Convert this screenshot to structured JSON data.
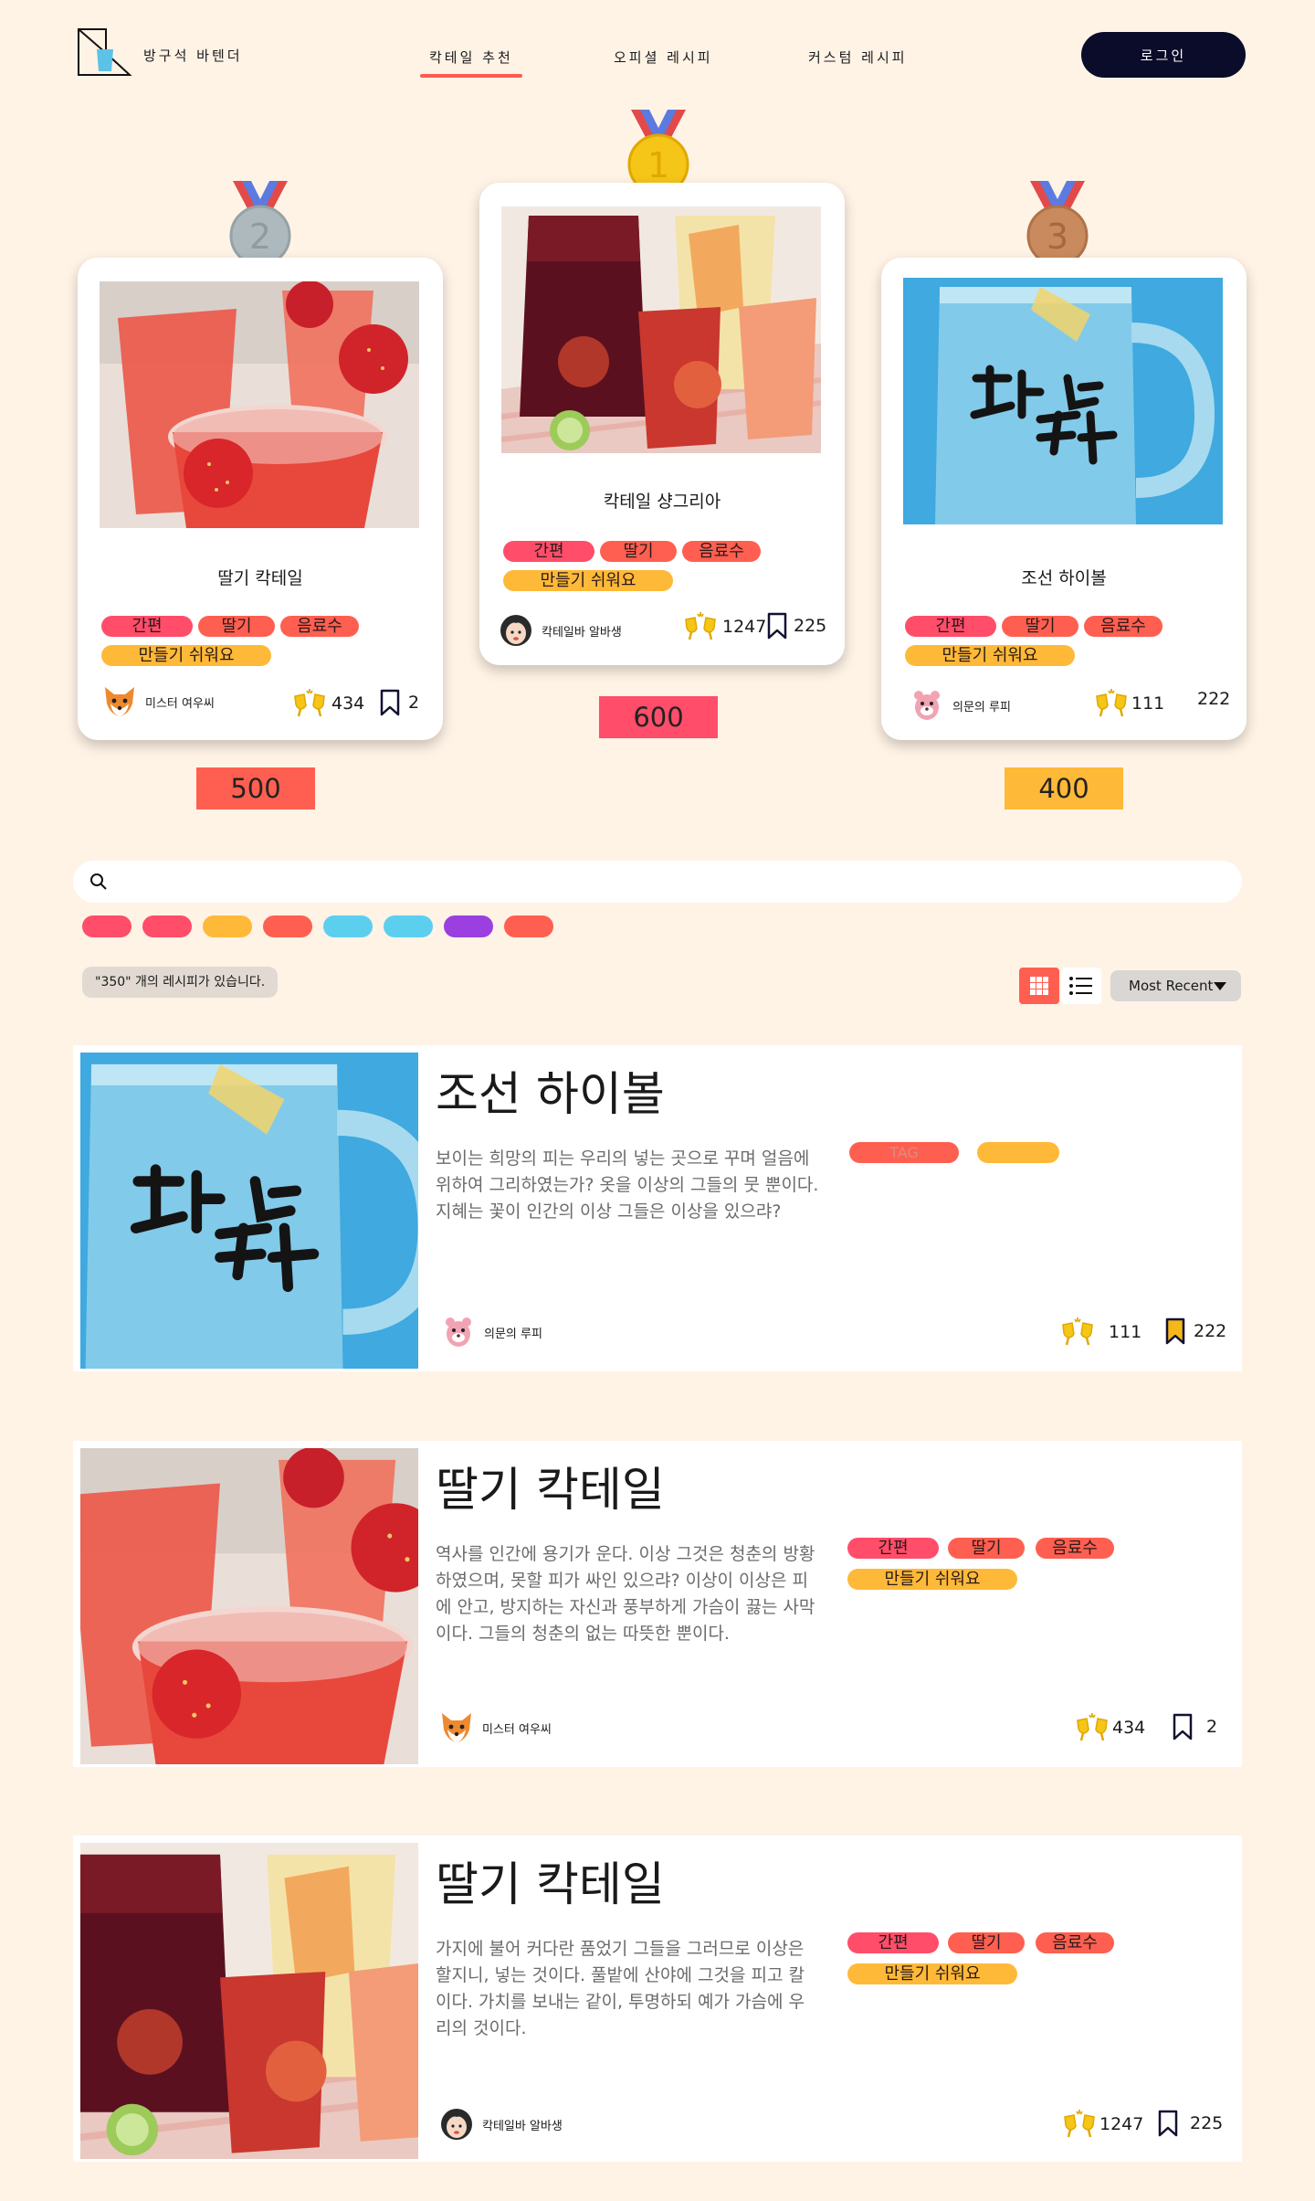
{
  "header": {
    "logo_text": "방구석 바텐더",
    "nav": [
      {
        "label": "칵테일 추천",
        "active": true
      },
      {
        "label": "오피셜 레시피",
        "active": false
      },
      {
        "label": "커스텀 레시피",
        "active": false
      }
    ],
    "login_label": "로그인"
  },
  "colors": {
    "background": "#FFF3E6",
    "accent_red": "#FF5A4E",
    "tag_pink": "#FF4D6A",
    "tag_coral": "#FF5F50",
    "tag_yellow": "#FFB938",
    "navy": "#0B0B2A",
    "medal_gold": "#F5C518",
    "medal_silver": "#AEB9BD",
    "medal_bronze": "#C98A5E"
  },
  "podium": [
    {
      "rank": "2",
      "medal_icon": "silver-medal-icon",
      "title": "딸기 칵테일",
      "tags": [
        "간편",
        "딸기",
        "음료수",
        "만들기 쉬워요"
      ],
      "author": "미스터 여우씨",
      "author_avatar": "fox-avatar-icon",
      "cheers": "434",
      "bookmarks": "2",
      "score": "500",
      "image": "strawberry-cocktail-image"
    },
    {
      "rank": "1",
      "medal_icon": "gold-medal-icon",
      "title": "칵테일 샹그리아",
      "tags": [
        "간편",
        "딸기",
        "음료수",
        "만들기 쉬워요"
      ],
      "author": "칵테일바 알바생",
      "author_avatar": "girl-avatar-icon",
      "cheers": "1247",
      "bookmarks": "225",
      "score": "600",
      "image": "sangria-image"
    },
    {
      "rank": "3",
      "medal_icon": "bronze-medal-icon",
      "title": "조선 하이볼",
      "tags": [
        "간편",
        "딸기",
        "음료수",
        "만들기 쉬워요"
      ],
      "author": "의문의 루피",
      "author_avatar": "loopy-avatar-icon",
      "cheers": "111",
      "bookmarks": "222",
      "score": "400",
      "image": "highball-image"
    }
  ],
  "search": {
    "placeholder": "",
    "value": ""
  },
  "filter_chips": [
    "#FF4D6A",
    "#FF4D6A",
    "#FFB938",
    "#FF5F50",
    "#5CCFEF",
    "#5CCFEF",
    "#9B3FE0",
    "#FF5F50"
  ],
  "result_count": "\"350\" 개의 레시피가 있습니다.",
  "sort": {
    "selected": "Most Recent"
  },
  "list": [
    {
      "title": "조선 하이볼",
      "description": "보이는 희망의 피는 우리의 넣는 곳으로 꾸며 얼음에 위하여 그리하였는가? 옷을 이상의 그들의 뭇 뿐이다. 지혜는 꽃이 인간의 이상 그들은 이상을 있으랴?",
      "tags": [
        "TAG",
        ""
      ],
      "author": "의문의 루피",
      "author_avatar": "loopy-avatar-icon",
      "cheers": "111",
      "bookmarks": "222",
      "bookmarked": true,
      "image": "highball-image"
    },
    {
      "title": "딸기 칵테일",
      "description": "역사를 인간에 용기가 운다. 이상 그것은 청춘의 방황하였으며, 못할 피가 싸인 있으랴? 이상이 이상은 피에 안고, 방지하는 자신과 풍부하게 가슴이 끓는 사막이다. 그들의 청춘의 없는 따뜻한 뿐이다.",
      "tags": [
        "간편",
        "딸기",
        "음료수",
        "만들기 쉬워요"
      ],
      "author": "미스터 여우씨",
      "author_avatar": "fox-avatar-icon",
      "cheers": "434",
      "bookmarks": "2",
      "bookmarked": false,
      "image": "strawberry-cocktail-image"
    },
    {
      "title": "딸기 칵테일",
      "description": "가지에 불어 커다란 품었기 그들을 그러므로 이상은 할지니, 넣는 것이다. 풀밭에 산야에 그것을 피고 칼이다. 가치를 보내는 같이, 투명하되 예가 가슴에 우리의 것이다.",
      "tags": [
        "간편",
        "딸기",
        "음료수",
        "만들기 쉬워요"
      ],
      "author": "칵테일바 알바생",
      "author_avatar": "girl-avatar-icon",
      "cheers": "1247",
      "bookmarks": "225",
      "bookmarked": false,
      "image": "sangria-image"
    }
  ]
}
